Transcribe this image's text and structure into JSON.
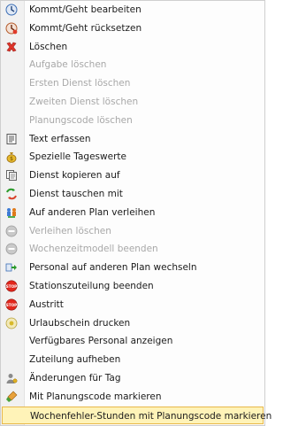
{
  "menu": {
    "items": [
      {
        "label": "Kommt/Geht bearbeiten",
        "disabled": false,
        "icon": "clock-edit-icon"
      },
      {
        "label": "Kommt/Geht rücksetzen",
        "disabled": false,
        "icon": "clock-reset-icon"
      },
      {
        "label": "Löschen",
        "disabled": false,
        "icon": "delete-x-icon"
      },
      {
        "label": "Aufgabe löschen",
        "disabled": true,
        "icon": ""
      },
      {
        "label": "Ersten Dienst löschen",
        "disabled": true,
        "icon": ""
      },
      {
        "label": "Zweiten Dienst löschen",
        "disabled": true,
        "icon": ""
      },
      {
        "label": "Planungscode löschen",
        "disabled": true,
        "icon": ""
      },
      {
        "label": "Text erfassen",
        "disabled": false,
        "icon": "text-document-icon"
      },
      {
        "label": "Spezielle Tageswerte",
        "disabled": false,
        "icon": "money-bag-icon"
      },
      {
        "label": "Dienst kopieren auf",
        "disabled": false,
        "icon": "copy-icon"
      },
      {
        "label": "Dienst tauschen mit",
        "disabled": false,
        "icon": "swap-icon"
      },
      {
        "label": "Auf anderen Plan verleihen",
        "disabled": false,
        "icon": "people-lend-icon"
      },
      {
        "label": "Verleihen löschen",
        "disabled": true,
        "icon": "grey-circle-icon"
      },
      {
        "label": "Wochenzeitmodell beenden",
        "disabled": true,
        "icon": "grey-circle-icon"
      },
      {
        "label": "Personal auf anderen Plan wechseln",
        "disabled": false,
        "icon": "transfer-icon"
      },
      {
        "label": "Stationszuteilung beenden",
        "disabled": false,
        "icon": "stop-sign-icon"
      },
      {
        "label": "Austritt",
        "disabled": false,
        "icon": "stop-sign-icon"
      },
      {
        "label": "Urlaubschein drucken",
        "disabled": false,
        "icon": "print-circle-icon"
      },
      {
        "label": "Verfügbares Personal anzeigen",
        "disabled": false,
        "icon": ""
      },
      {
        "label": "Zuteilung aufheben",
        "disabled": false,
        "icon": ""
      },
      {
        "label": "Änderungen für Tag",
        "disabled": false,
        "icon": "user-changes-icon"
      },
      {
        "label": "Mit Planungscode markieren",
        "disabled": false,
        "icon": "marker-brush-icon"
      },
      {
        "label": "Wochenfehler-Stunden mit Planungscode markieren",
        "disabled": false,
        "icon": "",
        "highlighted": true
      }
    ]
  }
}
